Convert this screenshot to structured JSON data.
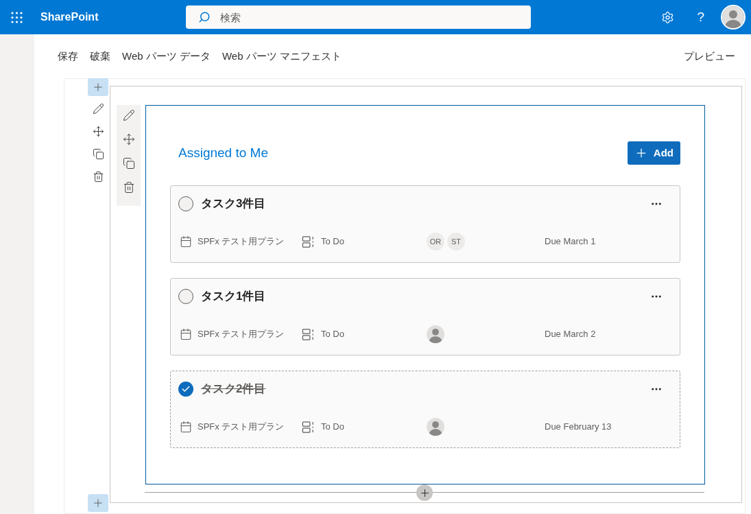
{
  "header": {
    "app_name": "SharePoint",
    "search_placeholder": "検索",
    "help": "?"
  },
  "commands": [
    "保存",
    "破棄",
    "Web パーツ データ",
    "Web パーツ マニフェスト"
  ],
  "preview": "プレビュー",
  "webpart": {
    "title": "Assigned to Me",
    "add_label": "Add",
    "tasks": [
      {
        "title": "タスク3件目",
        "completed": false,
        "plan": "SPFx テスト用プラン",
        "bucket": "To Do",
        "assignees": [
          {
            "kind": "initials",
            "text": "OR"
          },
          {
            "kind": "initials",
            "text": "ST"
          }
        ],
        "due": "Due March 1"
      },
      {
        "title": "タスク1件目",
        "completed": false,
        "plan": "SPFx テスト用プラン",
        "bucket": "To Do",
        "assignees": [
          {
            "kind": "photo"
          }
        ],
        "due": "Due March 2"
      },
      {
        "title": "タスク2件目",
        "completed": true,
        "plan": "SPFx テスト用プラン",
        "bucket": "To Do",
        "assignees": [
          {
            "kind": "photo"
          }
        ],
        "due": "Due February 13"
      }
    ]
  }
}
